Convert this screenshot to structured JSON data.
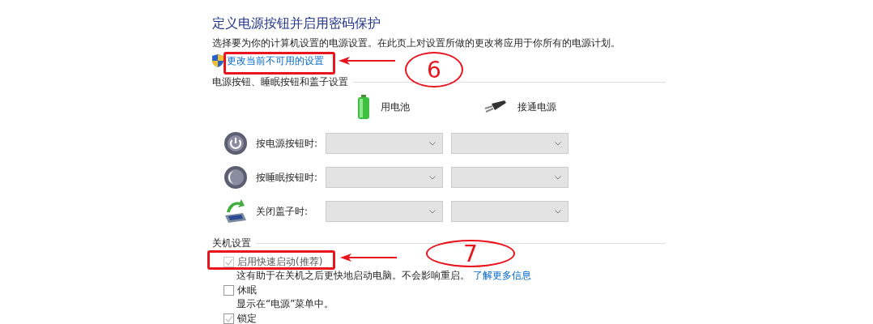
{
  "title": "定义电源按钮并启用密码保护",
  "description": "选择要为你的计算机设置的电源设置。在此页上对设置所做的更改将应用于你所有的电源计划。",
  "admin_link": "更改当前不可用的设置",
  "buttons_section": {
    "heading": "电源按钮、睡眠按钮和盖子设置",
    "columns": [
      {
        "kind": "battery",
        "label": "用电池"
      },
      {
        "kind": "plug",
        "label": "接通电源"
      }
    ],
    "rows": [
      {
        "kind": "power",
        "label": "按电源按钮时:",
        "dropdowns": [
          {
            "disabled": true
          },
          {
            "disabled": true
          }
        ]
      },
      {
        "kind": "sleep",
        "label": "按睡眠按钮时:",
        "dropdowns": [
          {
            "disabled": true
          },
          {
            "disabled": true
          }
        ]
      },
      {
        "kind": "lid",
        "label": "关闭盖子时:",
        "dropdowns": [
          {
            "disabled": true
          },
          {
            "disabled": true
          }
        ]
      }
    ]
  },
  "shutdown_section": {
    "heading": "关机设置",
    "options": [
      {
        "label": "启用快速启动(推荐)",
        "checked": true,
        "disabled": true,
        "note": "这有助于在关机之后更快地启动电脑。不会影响重启。",
        "link": "了解更多信息"
      },
      {
        "label": "休眠",
        "checked": false,
        "disabled": false,
        "note": "显示在“电源”菜单中。"
      },
      {
        "label": "锁定",
        "checked": true,
        "disabled": false
      }
    ]
  },
  "annotations": [
    {
      "label": "6"
    },
    {
      "label": "7"
    }
  ]
}
